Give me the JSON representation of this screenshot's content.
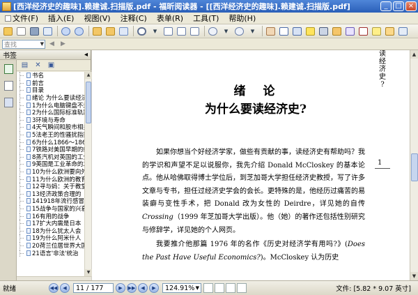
{
  "window": {
    "title": "[西洋经济史的趣味].赖建诚.扫描版.pdf - 福昕阅读器 - [[西洋经济史的趣味].赖建诚.扫描版.pdf]",
    "controls": {
      "minimize": "_",
      "maximize": "□",
      "close": "×"
    }
  },
  "menu": {
    "items": [
      "文件(F)",
      "插入(E)",
      "视图(V)",
      "注释(C)",
      "表单(R)",
      "工具(T)",
      "帮助(H)"
    ]
  },
  "search": {
    "placeholder": "查找"
  },
  "panel": {
    "title": "书签",
    "collapse": "◂",
    "bookmarks": [
      "书名",
      "前言",
      "目录",
      "绪论  为什么要读经济史?",
      "1为什么电脑键盘不是ABCD顺序",
      "2为什么国际标准轨距是4英尺8.5英寸",
      "3环境与寿命",
      "4天气瞬间和股市相关吗",
      "5法老王的性骚扰指控",
      "6为什么1866～1867年",
      "7铁路对美国早期的经济增长",
      "8蒸汽机对英国的工业革命",
      "9英国是工业革命的发源地吗",
      "10为什么欧洲要向外",
      "11为什么欧洲的教育",
      "12寻与蚂：关于教堂",
      "13经济政策合理的",
      "141918年流行感冒",
      "15战争与国家的兴衰",
      "16有用的战争",
      "17扩大内需是日本",
      "18为什么犹太人会",
      "19为什么阿米什人",
      "20荷兰位居世界大国",
      "21语言'非法'统治"
    ]
  },
  "document": {
    "running_head": [
      "读",
      "经",
      "济",
      "史",
      "?"
    ],
    "page_number": "1",
    "chapter_title": "绪　论",
    "chapter_subtitle": "为什么要读经济史?",
    "paragraph1": "如果你想当个好经济学家，做些有贡献的事，读经济史有帮助吗？我的学识和声望不足以说服你，我先介绍 Donald McCloskey 的基本论点。他从哈佛取得博士学位后，到芝加哥大学担任经济史教授，写了许多文章与专书，担任过经济史学会的会长。更特殊的是，他经历过痛苦的易装癖与变性手术，把 Donald 改为女性的 Deirdre，详见她的自传 ",
    "paragraph1_italic": "Crossing",
    "paragraph1_end": "（1999 年芝加哥大学出版）。他（她）的著作还包括性别研究与修辞学，详见她的个人网页。",
    "paragraph2": "我要推介他那篇 1976 年的名作《历史对经济学有用吗?》(",
    "paragraph2_italic": "Does the Past Have Useful Economics?",
    "paragraph2_end": ")。McCloskey 认为历史"
  },
  "status": {
    "ready": "就绪",
    "page": "11 / 177",
    "zoom": "124.91%",
    "doc_size": "文件: [5.82 * 9.07 英寸]"
  }
}
